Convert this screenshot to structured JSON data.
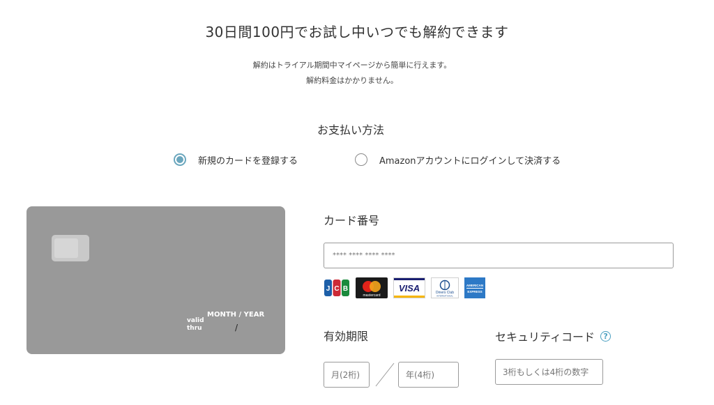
{
  "headline": "30日間100円でお試し中いつでも解約できます",
  "subtext": {
    "line1": "解約はトライアル期間中マイページから簡単に行えます。",
    "line2": "解約料金はかかりません。"
  },
  "payment_method": {
    "title": "お支払い方法",
    "options": [
      {
        "label": "新規のカードを登録する",
        "selected": true
      },
      {
        "label": "Amazonアカウントにログインして決済する",
        "selected": false
      }
    ]
  },
  "card_preview": {
    "valid_thru_line1": "valid",
    "valid_thru_line2": "thru",
    "month_year": "MONTH / YEAR",
    "separator": "/"
  },
  "card_number": {
    "label": "カード番号",
    "placeholder": "**** **** **** ****"
  },
  "brands": [
    "JCB",
    "mastercard",
    "VISA",
    "Diners Club INTERNATIONAL",
    "AMERICAN EXPRESS"
  ],
  "expiry": {
    "label": "有効期限",
    "month_placeholder": "月(2桁)",
    "year_placeholder": "年(4桁)"
  },
  "security_code": {
    "label": "セキュリティコード",
    "help_icon": "?",
    "placeholder": "3桁もしくは4桁の数字"
  },
  "colors": {
    "accent": "#6aa6bd",
    "card_bg": "#999999",
    "help": "#4a9fc0"
  }
}
